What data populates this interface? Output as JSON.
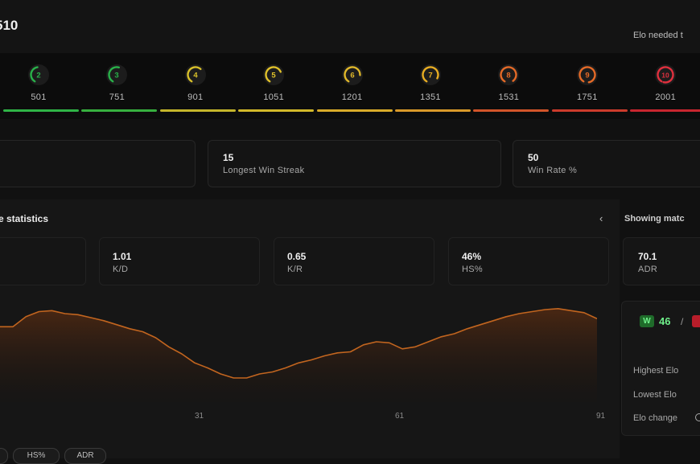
{
  "header": {
    "elo_value": "510",
    "elo_needed_label": "Elo needed t"
  },
  "levels": [
    {
      "level": "2",
      "elo": "501",
      "color": "#29b24a",
      "bar_color": "#2fb447"
    },
    {
      "level": "3",
      "elo": "751",
      "color": "#29b24a",
      "bar_color": "#37b03f"
    },
    {
      "level": "4",
      "elo": "901",
      "color": "#d8c02a",
      "bar_color": "#c5b52b"
    },
    {
      "level": "5",
      "elo": "1051",
      "color": "#e0c12a",
      "bar_color": "#d2b92a"
    },
    {
      "level": "6",
      "elo": "1201",
      "color": "#e0b82a",
      "bar_color": "#d9ab2a"
    },
    {
      "level": "7",
      "elo": "1351",
      "color": "#e8ad22",
      "bar_color": "#d9992a"
    },
    {
      "level": "8",
      "elo": "1531",
      "color": "#e46a27",
      "bar_color": "#d2552a"
    },
    {
      "level": "9",
      "elo": "1751",
      "color": "#e46a27",
      "bar_color": "#cc3b2c"
    },
    {
      "level": "10",
      "elo": "2001",
      "color": "#e0303e",
      "bar_color": "#c8262f"
    }
  ],
  "summary_cards": [
    {
      "value": "15",
      "label": "Longest Win Streak"
    },
    {
      "value": "50",
      "label": "Win Rate %"
    }
  ],
  "stats_section": {
    "title": "e statistics",
    "back_chevron": "‹",
    "showing_label": "Showing matc",
    "mini_stats": [
      {
        "value": "1.01",
        "label": "K/D"
      },
      {
        "value": "0.65",
        "label": "K/R"
      },
      {
        "value": "46%",
        "label": "HS%"
      },
      {
        "value": "70.1",
        "label": "ADR"
      }
    ]
  },
  "chart_data": {
    "type": "area",
    "x_ticks": [
      "31",
      "61",
      "91"
    ],
    "x": [
      1,
      3,
      5,
      7,
      9,
      11,
      13,
      15,
      17,
      19,
      21,
      23,
      25,
      27,
      29,
      31,
      33,
      35,
      37,
      39,
      41,
      43,
      45,
      47,
      49,
      51,
      53,
      55,
      57,
      59,
      61,
      63,
      65,
      67,
      69,
      71,
      73,
      75,
      77,
      79,
      81,
      83,
      85,
      87,
      89,
      91
    ],
    "values": [
      570,
      590,
      600,
      602,
      596,
      594,
      588,
      582,
      574,
      566,
      560,
      548,
      530,
      516,
      498,
      488,
      476,
      468,
      468,
      476,
      480,
      488,
      498,
      504,
      512,
      518,
      520,
      534,
      540,
      538,
      526,
      530,
      540,
      550,
      556,
      566,
      574,
      582,
      590,
      596,
      600,
      604,
      606,
      602,
      598,
      586
    ],
    "colors": {
      "line": "#c2651f",
      "fill_top": "#5a2d12",
      "fill_bottom": "#1a1411"
    }
  },
  "right_panel": {
    "w_badge": "W",
    "wins": "46",
    "slash": "/",
    "rows": [
      "Highest Elo",
      "Lowest Elo",
      "Elo change"
    ]
  },
  "chips": [
    "HS%",
    "ADR"
  ]
}
